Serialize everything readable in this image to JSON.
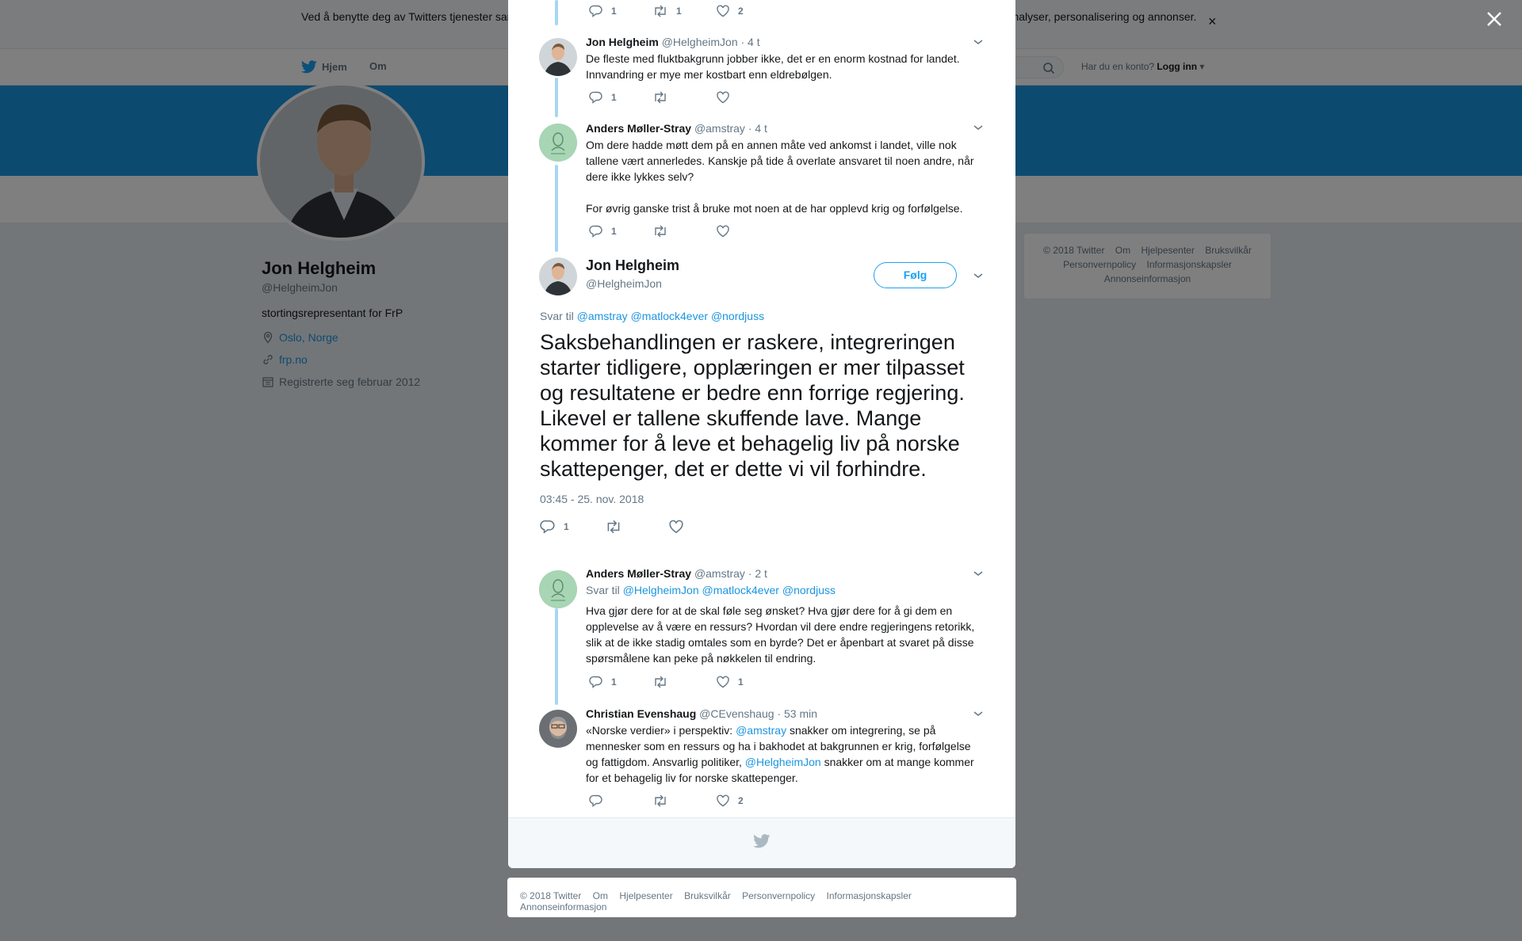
{
  "cookie_banner": {
    "text": "Ved å benytte deg av Twitters tjenester samtykker du til vår bruk av informasjonskapsler. Vi og våre partnere bruker informasjonskapsler til bl.a. analyser, personalisering og annonser.",
    "close": "×"
  },
  "topnav": {
    "home": "Hjem",
    "about": "Om",
    "login_prompt": "Har du en konto?",
    "login_link": "Logg inn"
  },
  "profile": {
    "name": "Jon Helgheim",
    "handle": "@HelgheimJon",
    "bio": "stortingsrepresentant for FrP",
    "location": "Oslo, Norge",
    "website": "frp.no",
    "joined": "Registrerte seg februar 2012"
  },
  "side_footer": {
    "items": [
      "© 2018 Twitter",
      "Om",
      "Hjelpesenter",
      "Bruksvilkår",
      "Personvernpolicy",
      "Informasjonskapsler",
      "Annonseinformasjon"
    ]
  },
  "modal": {
    "top_actions": {
      "replies": "1",
      "retweets": "1",
      "likes": "2"
    },
    "tweets": [
      {
        "name": "Jon Helgheim",
        "handle": "@HelgheimJon",
        "time": "· 4 t",
        "text": "De fleste med fluktbakgrunn jobber ikke, det er en enorm kostnad for landet. Innvandring er mye mer kostbart enn eldrebølgen.",
        "replies": "1",
        "retweets": "",
        "likes": ""
      },
      {
        "name": "Anders Møller-Stray",
        "handle": "@amstray",
        "time": "· 4 t",
        "text": "Om dere hadde møtt dem på en annen måte ved ankomst i landet, ville nok tallene vært annerledes. Kanskje på tide å overlate ansvaret til noen andre, når dere ikke lykkes selv?",
        "text2": "For øvrig ganske trist å bruke mot noen at de har opplevd krig og forfølgelse.",
        "replies": "1",
        "retweets": "",
        "likes": ""
      }
    ],
    "main_tweet": {
      "name": "Jon Helgheim",
      "handle": "@HelgheimJon",
      "follow": "Følg",
      "reply_prefix": "Svar til",
      "reply_to": [
        "@amstray",
        "@matlock4ever",
        "@nordjuss"
      ],
      "text": "Saksbehandlingen er raskere, integreringen starter tidligere, opplæringen er mer tilpasset og resultatene er bedre enn forrige regjering. Likevel er tallene skuffende lave. Mange kommer for å leve et behagelig liv på norske skattepenger, det er dette vi vil forhindre.",
      "date": "03:45 - 25. nov. 2018",
      "replies": "1",
      "retweets": "",
      "likes": ""
    },
    "replies": [
      {
        "name": "Anders Møller-Stray",
        "handle": "@amstray",
        "time": "· 2 t",
        "reply_prefix": "Svar til",
        "reply_to": [
          "@HelgheimJon",
          "@matlock4ever",
          "@nordjuss"
        ],
        "text": "Hva gjør dere for at de skal føle seg ønsket? Hva gjør dere for å gi dem en opplevelse av å være en ressurs? Hvordan vil dere endre regjeringens retorikk, slik at de ikke stadig omtales som en byrde? Det er åpenbart at svaret på disse spørsmålene kan peke på nøkkelen til endring.",
        "replies": "1",
        "retweets": "",
        "likes": "1"
      },
      {
        "name": "Christian Evenshaug",
        "handle": "@CEvenshaug",
        "time": "· 53 min",
        "text_a": "«Norske verdier» i perspektiv: ",
        "mention_a": "@amstray",
        "text_b": " snakker om integrering, se på mennesker som en ressurs og ha i bakhodet at bakgrunnen er krig, forfølgelse og fattigdom. Ansvarlig politiker, ",
        "mention_b": "@HelgheimJon",
        "text_c": " snakker om at mange kommer for et behagelig liv for norske skattepenger.",
        "replies": "",
        "retweets": "",
        "likes": "2"
      }
    ]
  },
  "bottom_footer": {
    "items": [
      "© 2018 Twitter",
      "Om",
      "Hjelpesenter",
      "Bruksvilkår",
      "Personvernpolicy",
      "Informasjonskapsler",
      "Annonseinformasjon"
    ]
  },
  "colors": {
    "brand": "#1da1f2",
    "link": "#1b95e0",
    "banner": "#1b95e0",
    "thread_line": "#a7d6f4"
  },
  "icons": [
    "twitter-bird-icon",
    "search-icon",
    "close-icon",
    "location-icon",
    "link-icon",
    "calendar-icon",
    "reply-icon",
    "retweet-icon",
    "like-icon",
    "chevron-down-icon"
  ]
}
